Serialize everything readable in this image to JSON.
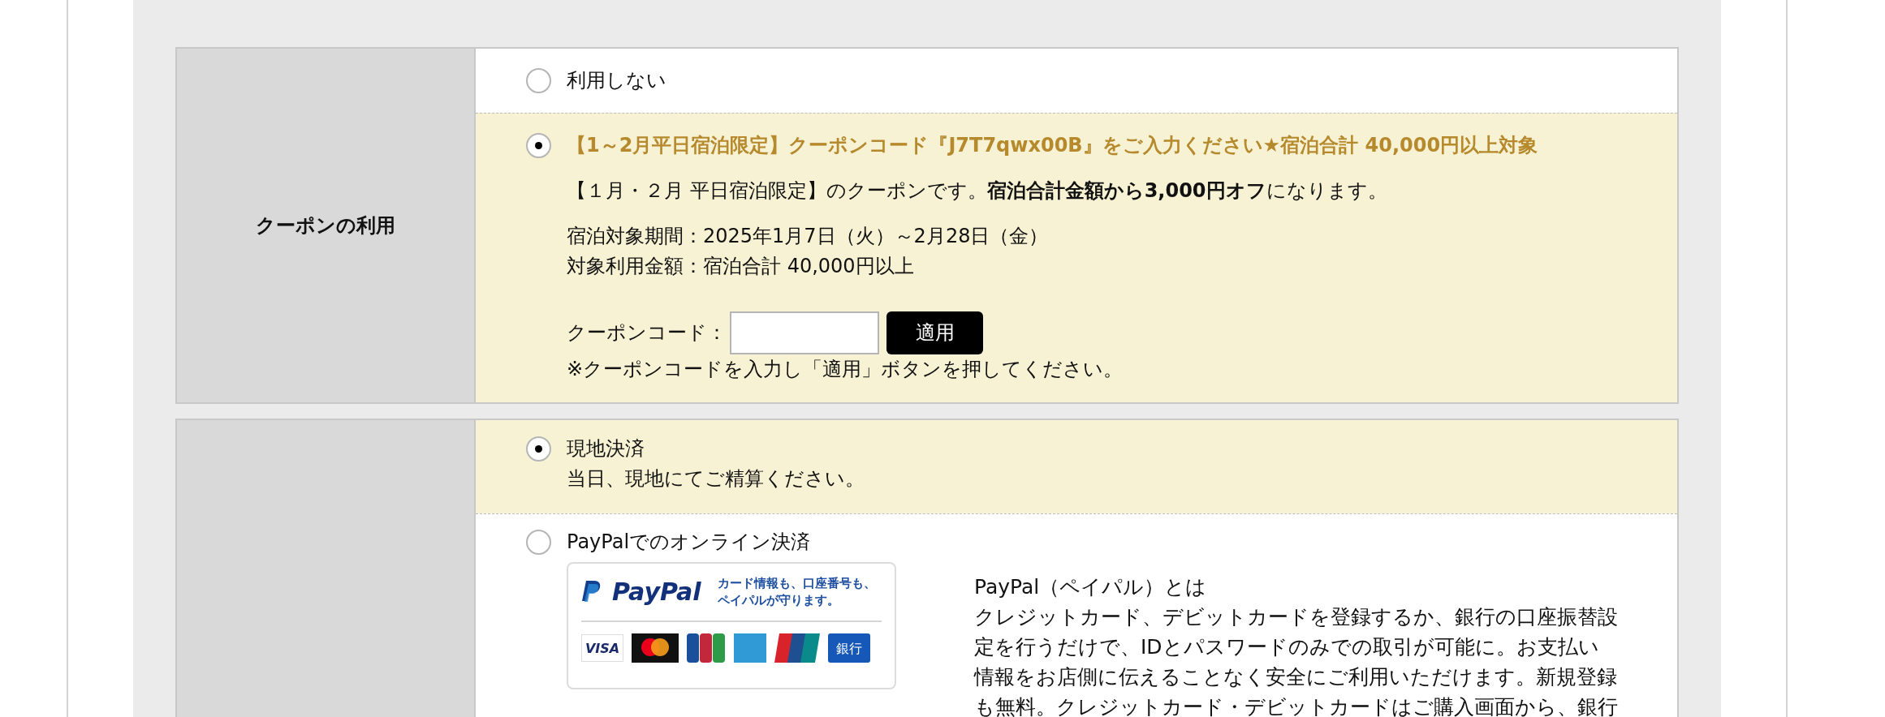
{
  "coupon_section": {
    "label": "クーポンの利用",
    "options": [
      {
        "kind": "plain",
        "label": "利用しない",
        "selected": false
      },
      {
        "kind": "coupon",
        "label": "【1～2月平日宿泊限定】クーポンコード『J7T7qwx00B』をご入力ください★宿泊合計 40,000円以上対象",
        "selected": true,
        "description": "【１月・２月 平日宿泊限定】のクーポンです。**宿泊合計金額から3,000円オフ**になります。",
        "details": [
          "宿泊対象期間：2025年1月7日（火）～2月28日（金）",
          "対象利用金額：宿泊合計 40,000円以上"
        ],
        "code_label": "クーポンコード：",
        "apply_button": "適用",
        "note": "※クーポンコードを入力し「適用」ボタンを押してください。"
      }
    ]
  },
  "payment_section": {
    "options": [
      {
        "kind": "onsite",
        "label": "現地決済",
        "selected": true,
        "description": "当日、現地にてご精算ください。"
      },
      {
        "kind": "paypal",
        "label": "PayPalでのオンライン決済",
        "selected": false,
        "banner": {
          "logo": "PayPal",
          "tagline": [
            "カード情報も、口座番号も、",
            "ペイパルが守ります。"
          ],
          "visa": "VISA",
          "bank": "銀行"
        },
        "about_title": "PayPal（ペイパル）とは",
        "about_lines": [
          "クレジットカード、デビットカードを登録するか、銀行の口座振替設",
          "定を行うだけで、IDとパスワードのみでの取引が可能に。お支払い",
          "情報をお店側に伝えることなく安全にご利用いただけます。新規登録",
          "も無料。クレジットカード・デビットカードはご購入画面から、銀行"
        ]
      }
    ]
  }
}
